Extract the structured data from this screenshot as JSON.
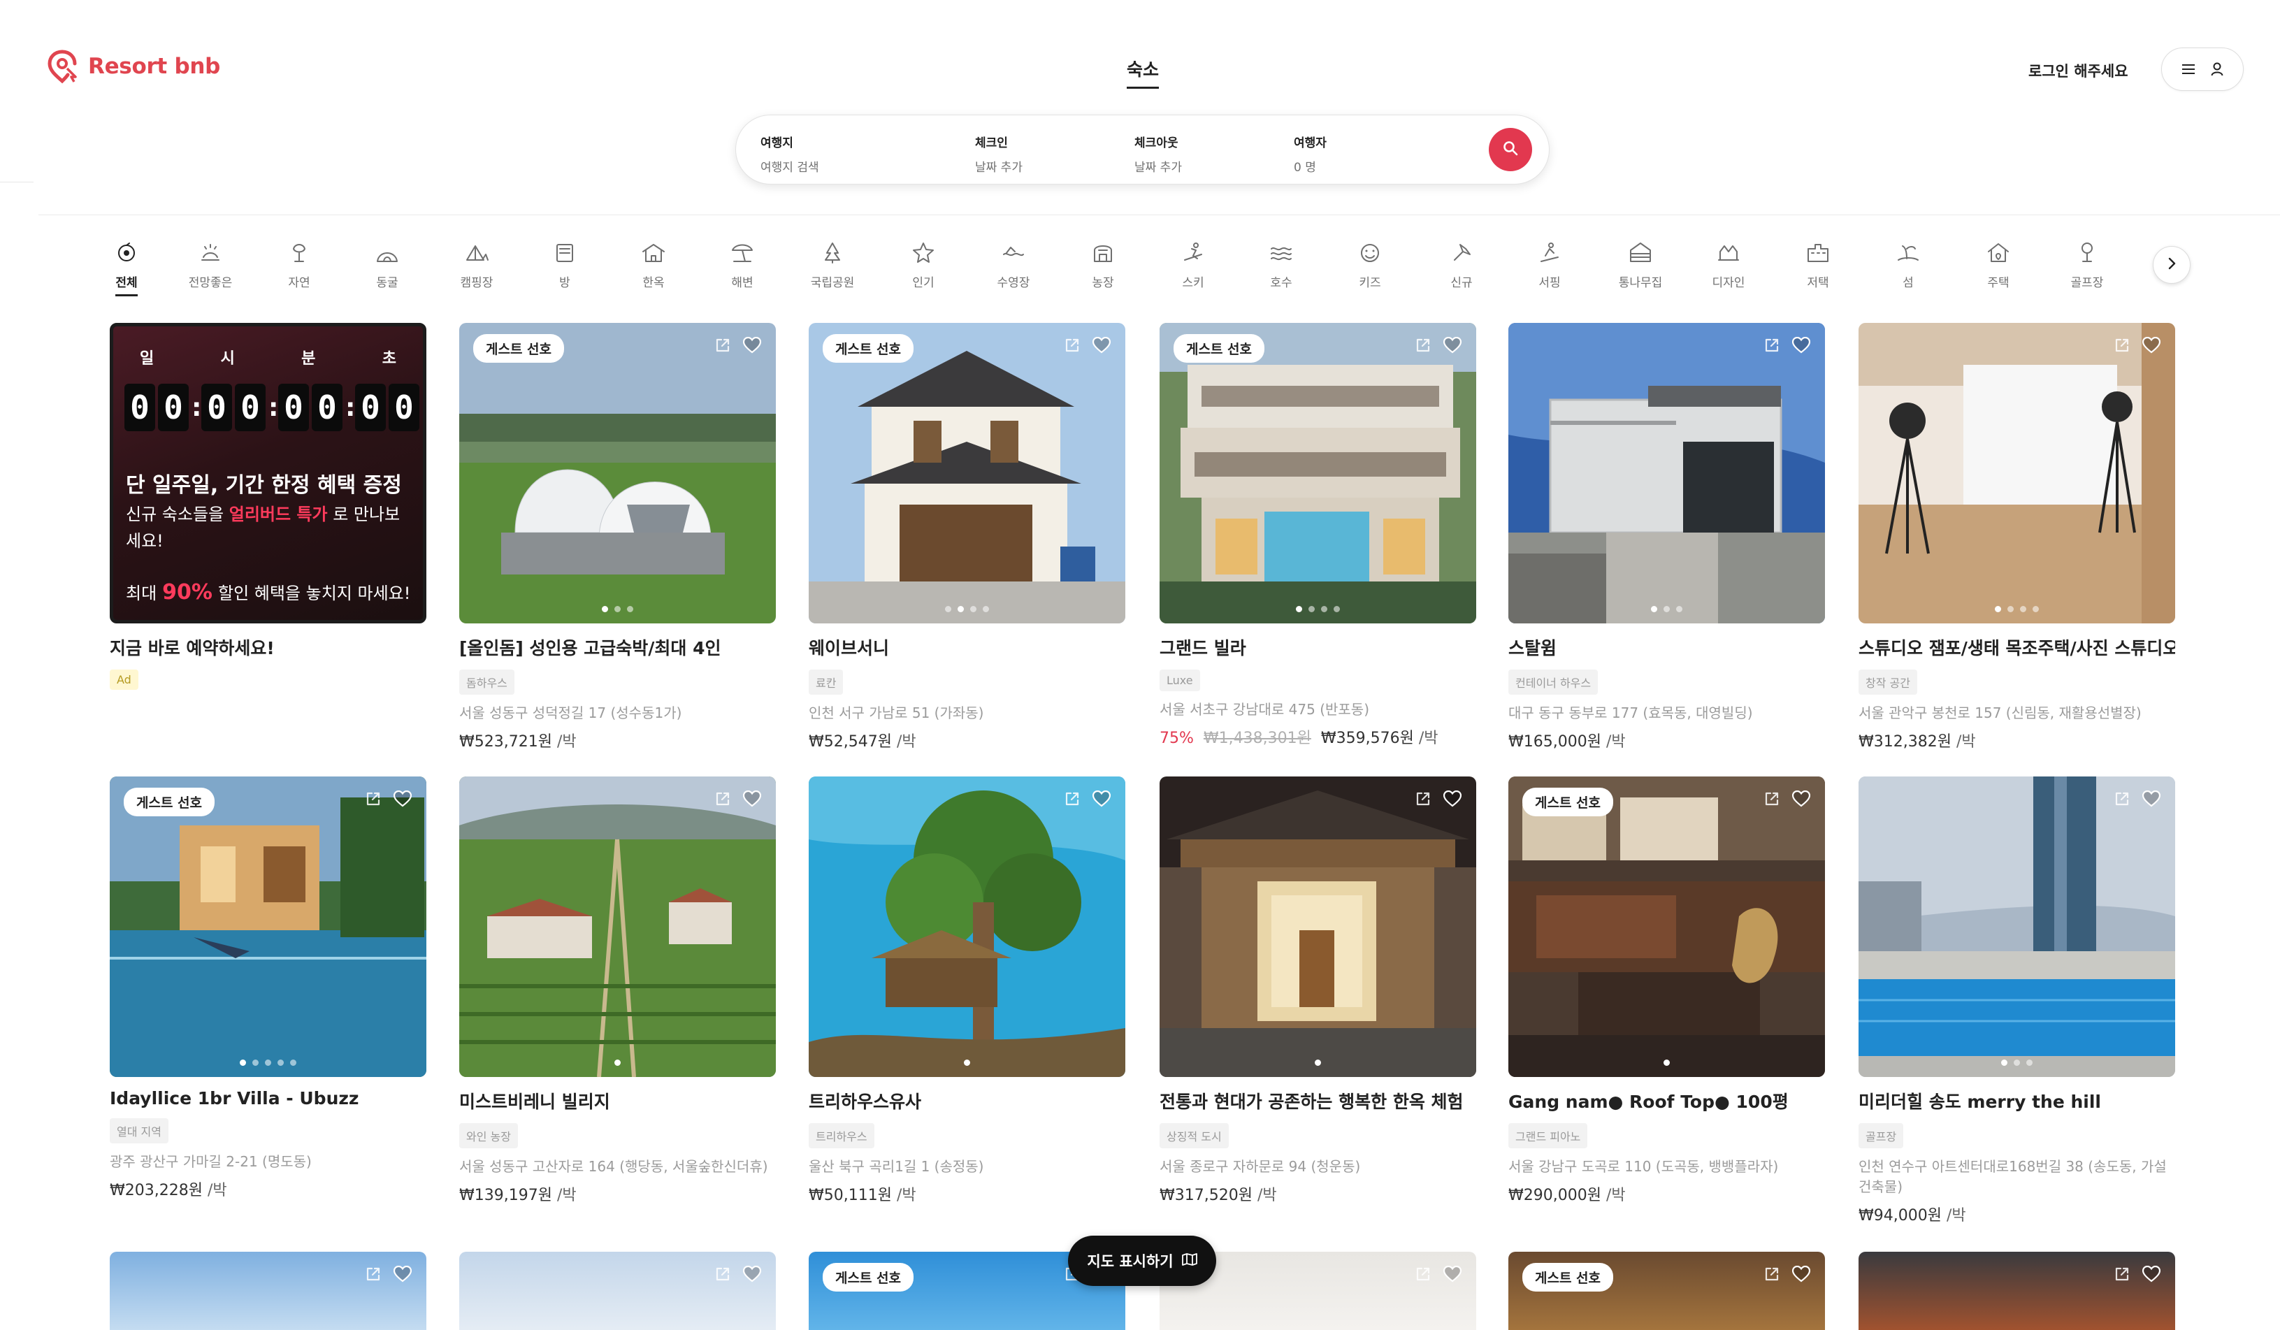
{
  "brand": {
    "name": "Resort bnb",
    "color": "#e0454f"
  },
  "header": {
    "nav_tab": "숙소",
    "login": "로그인 해주세요"
  },
  "search": {
    "destination": {
      "label": "여행지",
      "value": "여행지 검색"
    },
    "checkin": {
      "label": "체크인",
      "value": "날짜 추가"
    },
    "checkout": {
      "label": "체크아웃",
      "value": "날짜 추가"
    },
    "guests": {
      "label": "여행자",
      "value": "0 명"
    }
  },
  "categories": [
    "전체",
    "전망좋은",
    "자연",
    "동굴",
    "캠핑장",
    "방",
    "한옥",
    "해변",
    "국립공원",
    "인기",
    "수영장",
    "농장",
    "스키",
    "호수",
    "키즈",
    "신규",
    "서핑",
    "통나무집",
    "디자인",
    "저택",
    "섬",
    "주택",
    "골프장"
  ],
  "promo": {
    "units": [
      "일",
      "시",
      "분",
      "초"
    ],
    "digits": [
      "0",
      "0",
      "0",
      "0",
      "0",
      "0",
      "0",
      "0"
    ],
    "line1": "단 일주일, 기간 한정 혜택 증정",
    "line2a": "신규 숙소들을 ",
    "line2b": "얼리버드 특가",
    "line2c": " 로 만나보세요!",
    "line3a": "최대",
    "line3b": "90%",
    "line3c": "할인 혜택을 놓치지 마세요!",
    "title": "지금 바로 예약하세요!",
    "ad": "Ad"
  },
  "badge_label": "게스트 선호",
  "listings": [
    {
      "title": "[올인돔] 성인용 고급숙박/최대 4인",
      "tag": "돔하우스",
      "addr": "서울 성동구 성덕정길 17 (성수동1가)",
      "price": "₩523,721원",
      "unit": "/박"
    },
    {
      "title": "웨이브서니",
      "tag": "료칸",
      "addr": "인천 서구 가남로 51 (가좌동)",
      "price": "₩52,547원",
      "unit": "/박"
    },
    {
      "title": "그랜드 빌라",
      "tag": "Luxe",
      "addr": "서울 서초구 강남대로 475 (반포동)",
      "discount": "75%",
      "original": "₩1,438,301원",
      "price": "₩359,576원",
      "unit": "/박"
    },
    {
      "title": "스탈윔",
      "tag": "컨테이너 하우스",
      "addr": "대구 동구 동부로 177 (효목동, 대영빌딩)",
      "price": "₩165,000원",
      "unit": "/박"
    },
    {
      "title": "스튜디오 잼포/생태 목조주택/사진 스튜디오",
      "tag": "창작 공간",
      "addr": "서울 관악구 봉천로 157 (신림동, 재활용선별장)",
      "price": "₩312,382원",
      "unit": "/박"
    },
    {
      "title": "Idayllice 1br Villa - Ubuzz",
      "tag": "열대 지역",
      "addr": "광주 광산구 가마길 2-21 (명도동)",
      "price": "₩203,228원",
      "unit": "/박"
    },
    {
      "title": "미스트비레니 빌리지",
      "tag": "와인 농장",
      "addr": "서울 성동구 고산자로 164 (행당동, 서울숲한신더휴)",
      "price": "₩139,197원",
      "unit": "/박"
    },
    {
      "title": "트리하우스유사",
      "tag": "트리하우스",
      "addr": "울산 북구 곡리1길 1 (송정동)",
      "price": "₩50,111원",
      "unit": "/박"
    },
    {
      "title": "전통과 현대가 공존하는 행복한 한옥 체험",
      "tag": "상징적 도시",
      "addr": "서울 종로구 자하문로 94 (청운동)",
      "price": "₩317,520원",
      "unit": "/박"
    },
    {
      "title": "Gang nam● Roof Top● 100평",
      "tag": "그랜드 피아노",
      "addr": "서울 강남구 도곡로 110 (도곡동, 뱅뱅플라자)",
      "price": "₩290,000원",
      "unit": "/박"
    },
    {
      "title": "미리더힐 송도 merry the hill",
      "tag": "골프장",
      "addr": "인천 연수구 아트센터대로168번길 38 (송도동, 가설건축물)",
      "price": "₩94,000원",
      "unit": "/박"
    }
  ],
  "map_button": "지도 표시하기"
}
